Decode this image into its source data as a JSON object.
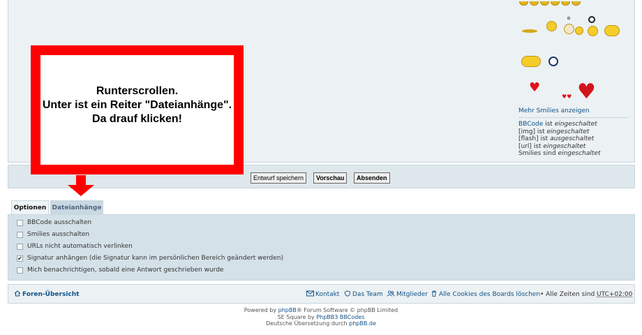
{
  "callout": {
    "line1": "Runterscrollen.",
    "line2": "Unter ist ein Reiter \"Dateianhänge\".",
    "line3": "Da drauf klicken!"
  },
  "smilies": {
    "more_link": "Mehr Smilies anzeigen"
  },
  "bbcode_status": {
    "bbcode_label": "BBCode",
    "bbcode_mid": " ist ",
    "bbcode_state": "eingeschaltet",
    "img_label": "[img]",
    "img_mid": " ist ",
    "img_state": "eingeschaltet",
    "flash_label": "[flash]",
    "flash_mid": " ist ",
    "flash_state": "ausgeschaltet",
    "url_label": "[url]",
    "url_mid": " ist ",
    "url_state": "eingeschaltet",
    "smilies_label": "Smilies sind ",
    "smilies_state": "eingeschaltet"
  },
  "buttons": {
    "draft": "Entwurf speichern",
    "preview": "Vorschau",
    "submit": "Absenden"
  },
  "tabs": {
    "options": "Optionen",
    "attachments": "Dateianhänge"
  },
  "options": [
    {
      "label": "BBCode ausschalten",
      "checked": false
    },
    {
      "label": "Smilies ausschalten",
      "checked": false
    },
    {
      "label": "URLs nicht automatisch verlinken",
      "checked": false
    },
    {
      "label": "Signatur anhängen (die Signatur kann im persönlichen Bereich geändert werden)",
      "checked": true
    },
    {
      "label": "Mich benachrichtigen, sobald eine Antwort geschrieben wurde",
      "checked": false
    }
  ],
  "footer_nav": {
    "index": "Foren-Übersicht",
    "contact": "Kontakt",
    "team": "Das Team",
    "members": "Mitglieder",
    "cookies": "Alle Cookies des Boards löschen",
    "tz_prefix": "• Alle Zeiten sind ",
    "tz_value": "UTC+02:00"
  },
  "credits": {
    "powered_prefix": "Powered by ",
    "phpbb": "phpBB",
    "powered_suffix": "® Forum Software © phpBB Limited",
    "style_prefix": "SE Square by ",
    "style_link": "PhpBB3 BBCodes",
    "translation_prefix": "Deutsche Übersetzung durch ",
    "translation_link": "phpBB.de"
  },
  "colors": {
    "callout_red": "#ff0000",
    "link_blue": "#105289",
    "panel_bg": "#ecf1f3",
    "options_bg": "#d4e1e9"
  }
}
